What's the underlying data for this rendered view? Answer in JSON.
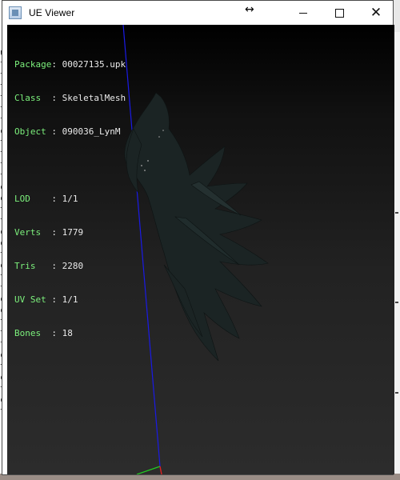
{
  "window": {
    "title": "UE Viewer",
    "controls": {
      "minimize_icon": "minimize-icon",
      "maximize_icon": "maximize-icon",
      "close_icon": "close-icon"
    }
  },
  "info": {
    "package": {
      "key": "Package",
      "value": "00027135.upk"
    },
    "class": {
      "key": "Class  ",
      "value": "SkeletalMesh"
    },
    "object": {
      "key": "Object ",
      "value": "090036_LynM"
    },
    "lod": {
      "key": "LOD    ",
      "value": "1/1"
    },
    "verts": {
      "key": "Verts  ",
      "value": "1779"
    },
    "tris": {
      "key": "Tris   ",
      "value": "2280"
    },
    "uvset": {
      "key": "UV Set ",
      "value": "1/1"
    },
    "bones": {
      "key": "Bones  ",
      "value": "18"
    },
    "separator": ": "
  },
  "colors": {
    "key_text": "#7cf07c",
    "value_text": "#eaeaea",
    "axis_blue": "#1a1ae6",
    "axis_green": "#22cc22",
    "axis_red": "#dd2222",
    "mesh": "#1b2424"
  },
  "background_left_glyphs": [
    "u",
    "t",
    "t",
    "t",
    "t",
    "t",
    "t",
    "c",
    "t",
    "t",
    "t",
    "t",
    "c",
    "c",
    "t",
    "t",
    "c",
    "c",
    "t",
    "c",
    "t",
    "t",
    "c",
    "c",
    "t",
    "t",
    "t",
    "c",
    "t",
    "c",
    "t",
    "c",
    "t"
  ]
}
